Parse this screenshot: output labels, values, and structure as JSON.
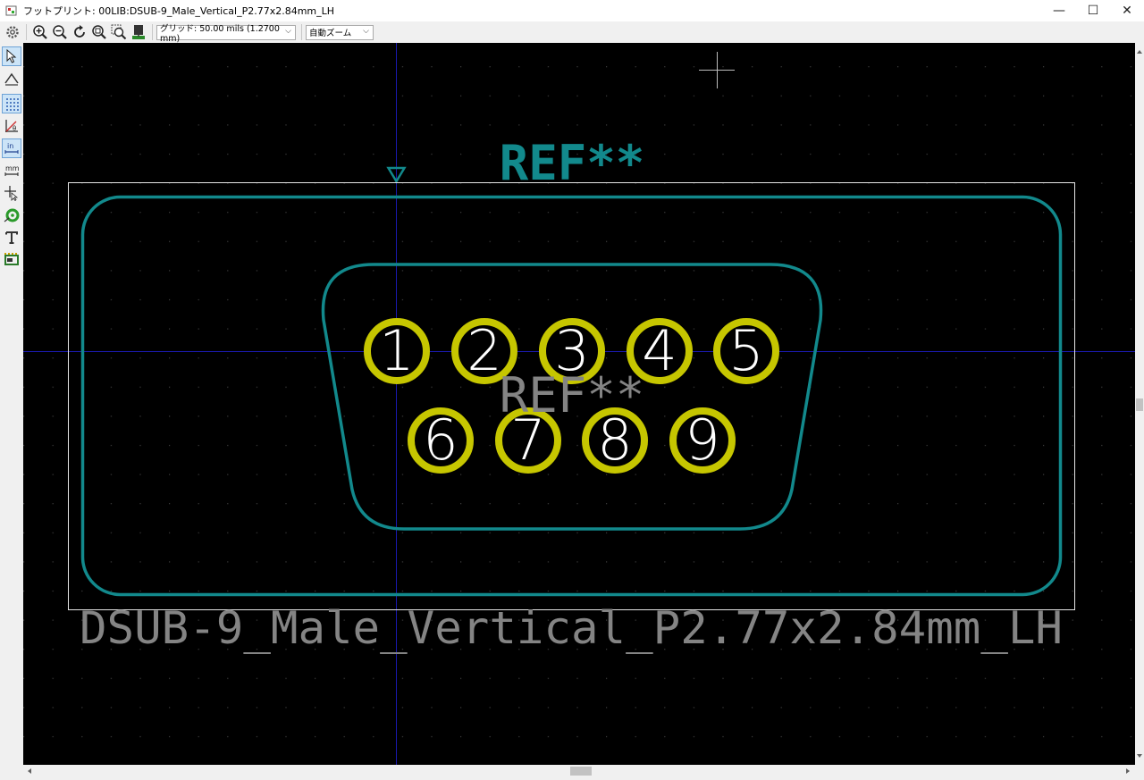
{
  "window": {
    "title": "フットプリント: 00LIB:DSUB-9_Male_Vertical_P2.77x2.84mm_LH",
    "minimize": "—",
    "maximize": "☐",
    "close": "✕"
  },
  "toolbar": {
    "grid_label": "グリッド: 50.00 mils (1.2700 mm)",
    "zoom_label": "自動ズーム",
    "buttons": [
      "settings-icon",
      "zoom-in-icon",
      "zoom-out-icon",
      "redraw-icon",
      "zoom-fit-icon",
      "zoom-selection-icon",
      "load-board-icon"
    ]
  },
  "left_toolbar": {
    "tools": [
      "select-icon",
      "measure-icon",
      "grid-toggle-icon",
      "polar-coords-icon",
      "units-inch-icon",
      "units-mm-icon",
      "cursor-crosshair-icon",
      "pad-icon",
      "text-icon",
      "layer-icon"
    ],
    "units_inch_label": "in",
    "units_mm_label": "mm"
  },
  "footprint": {
    "reference_top": "REF**",
    "reference_center": "REF**",
    "value": "DSUB-9_Male_Vertical_P2.77x2.84mm_LH",
    "pads": [
      "1",
      "2",
      "3",
      "4",
      "5",
      "6",
      "7",
      "8",
      "9"
    ]
  },
  "colors": {
    "canvas_bg": "#000000",
    "silkscreen": "#12898c",
    "pad_ring": "#c6c600",
    "courtyard": "#e6e6e6",
    "fab_text": "#848484",
    "axis": "#1a1ab0"
  }
}
